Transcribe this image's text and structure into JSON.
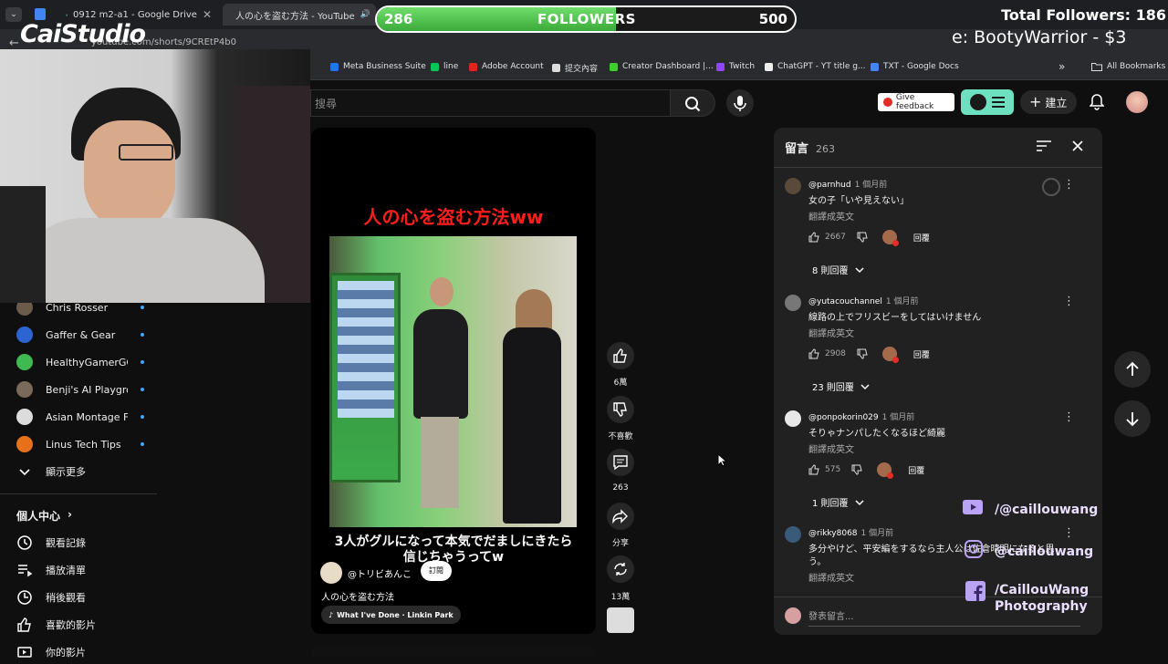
{
  "tabs": [
    {
      "title": "0912 m2-a1 - Google Drive"
    },
    {
      "title": "人の心を盗む方法 - YouTube"
    }
  ],
  "address": {
    "url": "youtube.com/shorts/9CREtP4b0"
  },
  "bookmarks": [
    {
      "label": "Meta Business Suite",
      "color": "#1877f2"
    },
    {
      "label": "line",
      "color": "#06c755"
    },
    {
      "label": "Adobe Account",
      "color": "#e1251b"
    },
    {
      "label": "提交內容",
      "color": "#dddddd"
    },
    {
      "label": "Creator Dashboard |...",
      "color": "#3ecf2e"
    },
    {
      "label": "Twitch",
      "color": "#9146ff"
    },
    {
      "label": "ChatGPT - YT title g...",
      "color": "#eeeeee"
    },
    {
      "label": "TXT - Google Docs",
      "color": "#4285f4"
    }
  ],
  "bookmarks_more": "»",
  "all_bookmarks": "All Bookmarks",
  "overlay": {
    "logo": "CaiStudio",
    "followers_current": "286",
    "followers_label": "FOLLOWERS",
    "followers_goal": "500",
    "followers_progress": 0.572,
    "total_followers": "Total Followers: 186",
    "donor": "e: BootyWarrior - $3"
  },
  "sidebar": {
    "subscriptions": [
      {
        "name": "Chris Rosser",
        "color": "#6b5b4b"
      },
      {
        "name": "Gaffer & Gear",
        "color": "#2c65d1"
      },
      {
        "name": "HealthyGamerGG",
        "color": "#3fb950"
      },
      {
        "name": "Benji's AI Playgro...",
        "color": "#7a6a5a"
      },
      {
        "name": "Asian Montage Film",
        "color": "#dcdcdc"
      },
      {
        "name": "Linus Tech Tips",
        "color": "#e7711b"
      }
    ],
    "show_more": "顯示更多",
    "you_section": "個人中心",
    "you_items": [
      "觀看記錄",
      "播放清單",
      "稍後觀看",
      "喜歡的影片",
      "你的影片"
    ]
  },
  "header": {
    "search_placeholder": "搜尋",
    "feedback": "Give feedback",
    "create": "建立"
  },
  "short": {
    "title_overlay": "人の心を盗む方法ww",
    "caption_overlay_line1": "3人がグルになって本気でだましにきたら",
    "caption_overlay_line2": "信じちゃうってw",
    "channel": "@トリビあんこ",
    "subscribe": "訂閱",
    "description": "人の心を盗む方法",
    "music": "What I've Done · Linkin Park"
  },
  "actions": {
    "likes": "6萬",
    "dislike": "不喜歡",
    "comments": "263",
    "share": "分享",
    "remix": "13萬"
  },
  "comments": {
    "title": "留言",
    "count": "263",
    "items": [
      {
        "user": "@parnhud",
        "time": "1 個月前",
        "text": "女の子「いや見えない」",
        "translate": "翻譯成英文",
        "likes": "2667",
        "reply": "回覆",
        "replies": "8 則回覆",
        "avatar": "#5a4a3a"
      },
      {
        "user": "@yutacouchannel",
        "time": "1 個月前",
        "text": "線路の上でフリスビーをしてはいけません",
        "translate": "翻譯成英文",
        "likes": "2908",
        "reply": "回覆",
        "replies": "23 則回覆",
        "avatar": "#777777"
      },
      {
        "user": "@ponpokorin029",
        "time": "1 個月前",
        "text": "そりゃナンパしたくなるほど綺麗",
        "translate": "翻譯成英文",
        "likes": "575",
        "reply": "回覆",
        "replies": "1 則回覆",
        "avatar": "#e8e8e8"
      },
      {
        "user": "@rikky8068",
        "time": "1 個月前",
        "text": "多分やけど、平安編をするなら主人公は佐倉晴明になると思",
        "text2": "う。",
        "translate": "翻譯成英文",
        "avatar": "#3a5a7a"
      }
    ],
    "add_placeholder": "發表留言..."
  },
  "socials": {
    "youtube": "/@caillouwang",
    "instagram": "@caillouwang",
    "facebook_line1": "/CaillouWang",
    "facebook_line2": "Photography"
  }
}
